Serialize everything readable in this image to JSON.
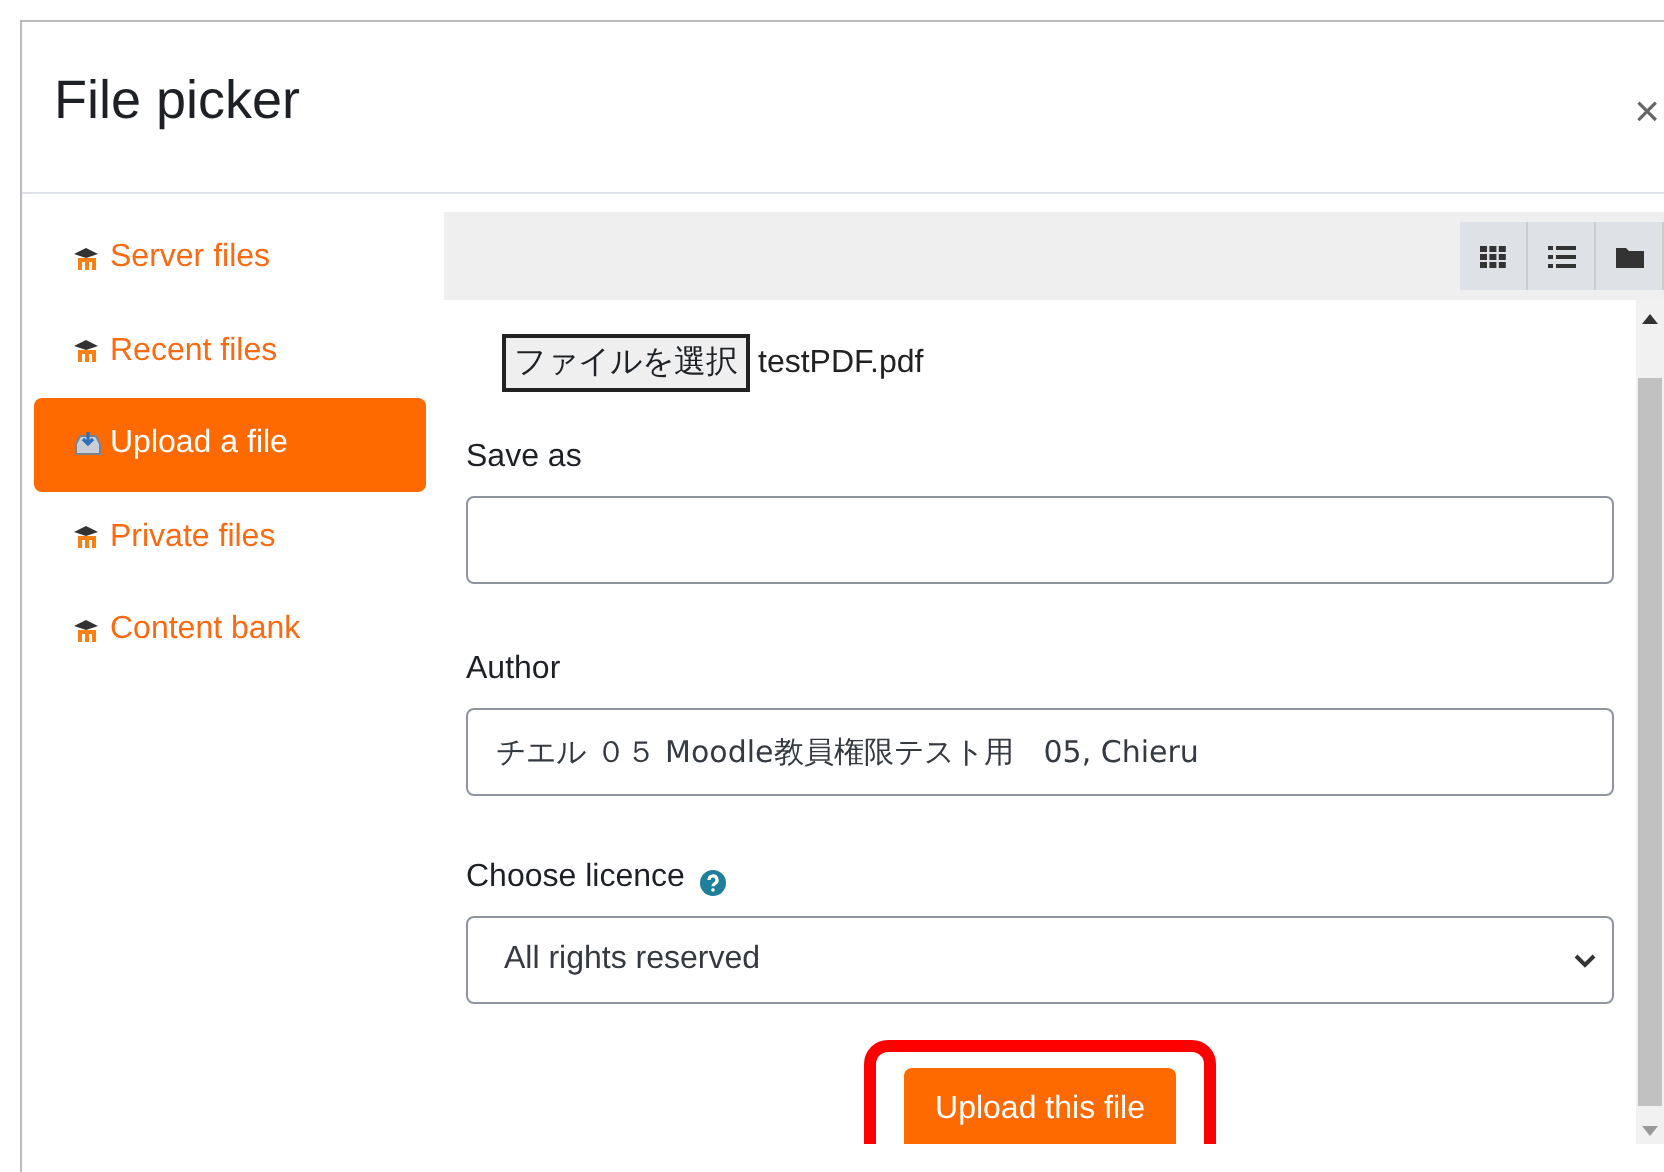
{
  "dialog": {
    "title": "File picker",
    "close": "×"
  },
  "sidebar": {
    "items": [
      {
        "label": "Server files",
        "kind": "repo",
        "selected": false
      },
      {
        "label": "Recent files",
        "kind": "repo",
        "selected": false
      },
      {
        "label": "Upload a file",
        "kind": "upload",
        "selected": true
      },
      {
        "label": "Private files",
        "kind": "repo",
        "selected": false
      },
      {
        "label": "Content bank",
        "kind": "repo",
        "selected": false
      }
    ]
  },
  "form": {
    "file_button": "ファイルを選択",
    "file_name": "testPDF.pdf",
    "fields": [
      {
        "kind": "text",
        "label": "Save as"
      },
      {
        "kind": "text",
        "label": "Author",
        "value": "チエル ０５ Moodle教員権限テスト用　05, Chieru"
      },
      {
        "kind": "select",
        "label": "Choose licence",
        "help": true,
        "value": "All rights reserved"
      }
    ],
    "submit": "Upload this file",
    "submit_highlighted": true
  }
}
